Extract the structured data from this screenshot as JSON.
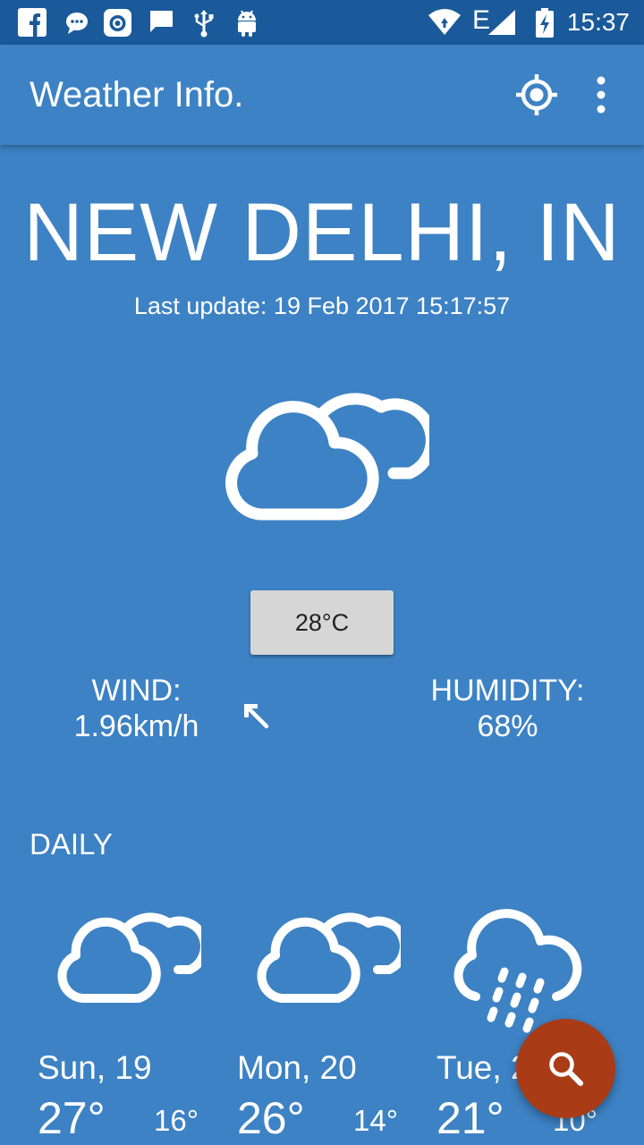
{
  "status_bar": {
    "time": "15:37",
    "network": "E",
    "icons": [
      "facebook-icon",
      "chat-icon",
      "camera-icon",
      "message-icon",
      "usb-icon",
      "android-icon",
      "wifi-icon",
      "signal-icon",
      "battery-charging-icon"
    ]
  },
  "app_bar": {
    "title": "Weather Info.",
    "actions": [
      "location-target-icon",
      "more-vert-icon"
    ]
  },
  "current": {
    "city": "NEW DELHI, IN",
    "last_update": "Last update: 19 Feb 2017 15:17:57",
    "condition_icon": "cloudy-icon",
    "temperature": "28°C",
    "wind_label": "WIND:",
    "wind_value": "1.96km/h",
    "wind_direction_icon": "arrow-up-left-icon",
    "humidity_label": "HUMIDITY:",
    "humidity_value": "68%"
  },
  "daily": {
    "label": "DAILY",
    "days": [
      {
        "name": "Sun, 19",
        "high": "27°",
        "low": "16°",
        "icon": "cloudy-icon"
      },
      {
        "name": "Mon, 20",
        "high": "26°",
        "low": "14°",
        "icon": "cloudy-icon"
      },
      {
        "name": "Tue, 2",
        "high": "21°",
        "low": "10°",
        "icon": "rain-icon"
      }
    ]
  },
  "fab": {
    "icon": "search-icon"
  },
  "colors": {
    "background": "#3d82c4",
    "status_bar": "#1a5a9a",
    "fab": "#a93b17",
    "temp_button": "#d6d6d6"
  }
}
